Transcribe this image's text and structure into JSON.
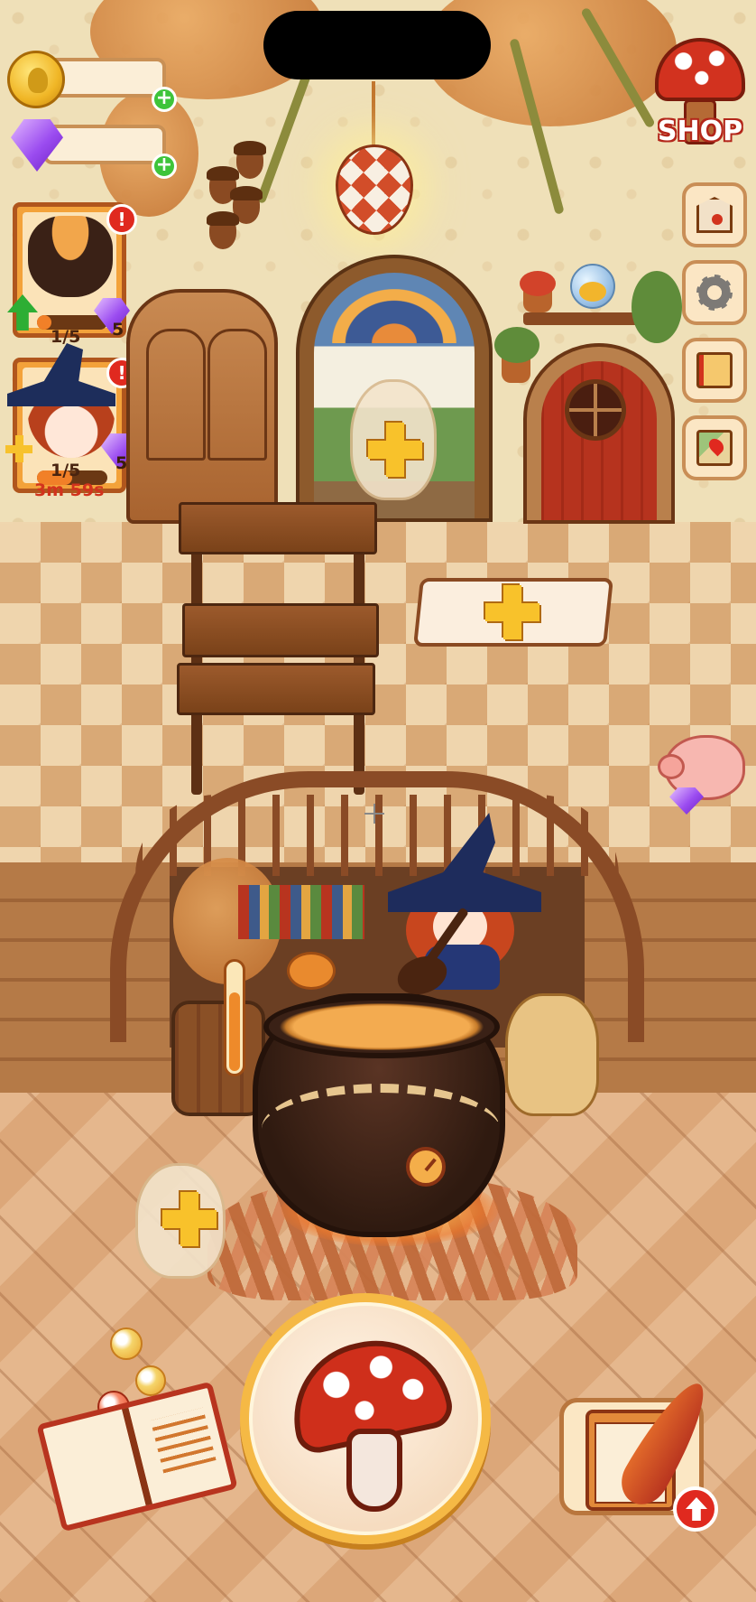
{
  "header": {
    "coins": {
      "value": "",
      "icon": "coin-icon"
    },
    "gems": {
      "value": "",
      "icon": "gem-icon"
    }
  },
  "upgrades": [
    {
      "name": "cauldron",
      "level": "1/5",
      "gem_cost": "5",
      "alert": "!",
      "progress": 0.2
    },
    {
      "name": "witch",
      "level": "1/5",
      "gem_cost": "50",
      "alert": "!",
      "timer": "3m 59s",
      "progress": 0.5
    }
  ],
  "side_menu": {
    "shop_label": "SHOP",
    "items": [
      "mail-icon",
      "gear-icon",
      "spellbook-icon",
      "map-icon"
    ]
  },
  "brew": {
    "thermometer_level": 0.7
  },
  "colors": {
    "accent_gold": "#f8c22b",
    "alert_red": "#e0291f",
    "plus_green": "#3ec43a"
  }
}
